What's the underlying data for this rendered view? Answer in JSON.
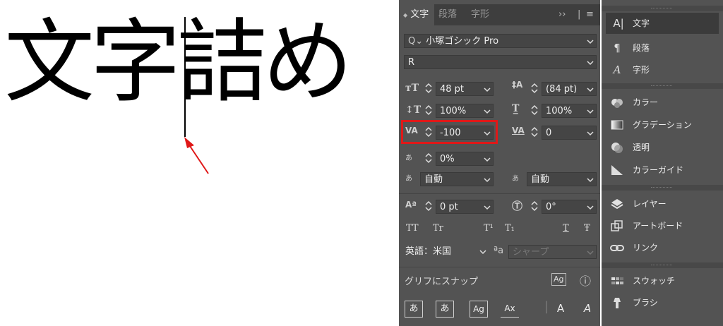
{
  "canvas": {
    "sample_text": "文字詰め"
  },
  "panel": {
    "tabs": [
      "文字",
      "段落",
      "字形"
    ],
    "tab_prefix": "◆",
    "overflow": "››",
    "font_family": "小塚ゴシック Pro",
    "font_style": "R",
    "font_size": "48 pt",
    "leading": "(84 pt)",
    "vertical_scale": "100%",
    "horizontal_scale": "100%",
    "tracking": "-100",
    "kerning": "0",
    "tsume": "0%",
    "aki_left": "自動",
    "aki_right": "自動",
    "baseline_shift": "0 pt",
    "rotation": "0°",
    "text_buttons": [
      "TT",
      "Tr",
      "T¹",
      "T₁",
      "T",
      "Ŧ"
    ],
    "language": "英語：米国",
    "antialias_icon": "ªa",
    "antialias": "シャープ",
    "snap_label": "グリフにスナップ",
    "bottom_buttons": [
      "あ",
      "あ",
      "Ag",
      "Ax",
      "A",
      "A"
    ]
  },
  "dock": {
    "items": [
      {
        "icon": "text-icon",
        "label": "文字"
      },
      {
        "icon": "paragraph-icon",
        "label": "段落"
      },
      {
        "icon": "glyph-icon",
        "label": "字形"
      },
      {
        "icon": "color-icon",
        "label": "カラー"
      },
      {
        "icon": "gradient-icon",
        "label": "グラデーション"
      },
      {
        "icon": "transparency-icon",
        "label": "透明"
      },
      {
        "icon": "color-guide-icon",
        "label": "カラーガイド"
      },
      {
        "icon": "layers-icon",
        "label": "レイヤー"
      },
      {
        "icon": "artboard-icon",
        "label": "アートボード"
      },
      {
        "icon": "links-icon",
        "label": "リンク"
      },
      {
        "icon": "swatches-icon",
        "label": "スウォッチ"
      },
      {
        "icon": "brushes-icon",
        "label": "ブラシ"
      }
    ]
  },
  "colors": {
    "panel_bg": "#535353",
    "highlight": "#e01818"
  }
}
